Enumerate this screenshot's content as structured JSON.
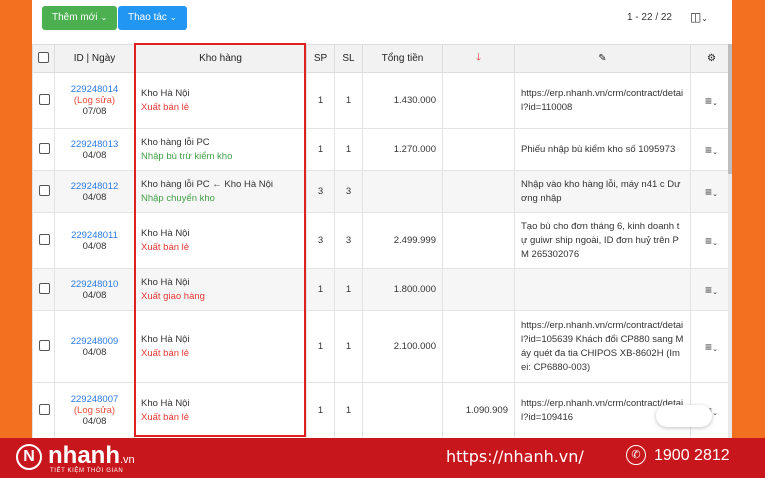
{
  "toolbar": {
    "add_label": "Thêm mới",
    "actions_label": "Thao tác",
    "pagination": "1 - 22 / 22",
    "caret": "⌄"
  },
  "table": {
    "headers": {
      "id_date": "ID | Ngày",
      "warehouse": "Kho hàng",
      "sp": "SP",
      "sl": "SL",
      "total": "Tổng tiền",
      "sort_arrow": "🡓",
      "note_icon": "✎",
      "settings_icon": "⚙"
    },
    "rows": [
      {
        "id": "229248014",
        "edit": "(Log sửa)",
        "date": "07/08",
        "warehouse": "Kho Hà Nội",
        "type": "Xuất bán lẻ",
        "type_color": "red",
        "sp": "1",
        "sl": "1",
        "total": "1.430.000",
        "extra": "",
        "note": "https://erp.nhanh.vn/crm/contract/detail?id=110008"
      },
      {
        "id": "229248013",
        "edit": "",
        "date": "04/08",
        "warehouse": "Kho hàng lỗi PC",
        "type": "Nhập bù trừ kiểm kho",
        "type_color": "green",
        "sp": "1",
        "sl": "1",
        "total": "1.270.000",
        "extra": "",
        "note": "Phiếu nhập bù kiểm kho số 1095973"
      },
      {
        "id": "229248012",
        "edit": "",
        "date": "04/08",
        "warehouse": "Kho hàng lỗi PC ← Kho Hà Nội",
        "type": "Nhập chuyển kho",
        "type_color": "green",
        "sp": "3",
        "sl": "3",
        "total": "",
        "extra": "",
        "note": "Nhập vào kho hàng lỗi, máy n41 c Dương nhập"
      },
      {
        "id": "229248011",
        "edit": "",
        "date": "04/08",
        "warehouse": "Kho Hà Nội",
        "type": "Xuất bán lẻ",
        "type_color": "red",
        "sp": "3",
        "sl": "3",
        "total": "2.499.999",
        "extra": "",
        "note": "Tạo bù cho đơn tháng 6, kinh doanh tự guiwr ship ngoài, ID đơn huỷ trên PM  265302076"
      },
      {
        "id": "229248010",
        "edit": "",
        "date": "04/08",
        "warehouse": "Kho Hà Nội",
        "type": "Xuất giao hàng",
        "type_color": "red",
        "sp": "1",
        "sl": "1",
        "total": "1.800.000",
        "extra": "",
        "note": ""
      },
      {
        "id": "229248009",
        "edit": "",
        "date": "04/08",
        "warehouse": "Kho Hà Nội",
        "type": "Xuất bán lẻ",
        "type_color": "red",
        "sp": "1",
        "sl": "1",
        "total": "2.100.000",
        "extra": "",
        "note": "https://erp.nhanh.vn/crm/contract/detail?id=105639 Khách đổi CP880 sang Máy quét đa tia CHIPOS XB-8602H (Imei: CP6880-003)"
      },
      {
        "id": "229248007",
        "edit": "(Log sửa)",
        "date": "04/08",
        "warehouse": "Kho Hà Nội",
        "type": "Xuất bán lẻ",
        "type_color": "red",
        "sp": "1",
        "sl": "1",
        "total": "",
        "extra": "1.090.909",
        "note": "https://erp.nhanh.vn/crm/contract/detail?id=109416"
      }
    ]
  },
  "footer": {
    "logo_mark": "N",
    "logo_text": "nhanh",
    "logo_suffix": ".vn",
    "tagline": "TIẾT KIỆM THỜI GIAN",
    "url": "https://nhanh.vn/",
    "phone_icon": "✆",
    "phone": "1900 2812"
  },
  "colors": {
    "accent_orange": "#f37021",
    "footer_red": "#c8161d",
    "link_blue": "#2a7ae2",
    "highlight_red": "#e02020"
  }
}
